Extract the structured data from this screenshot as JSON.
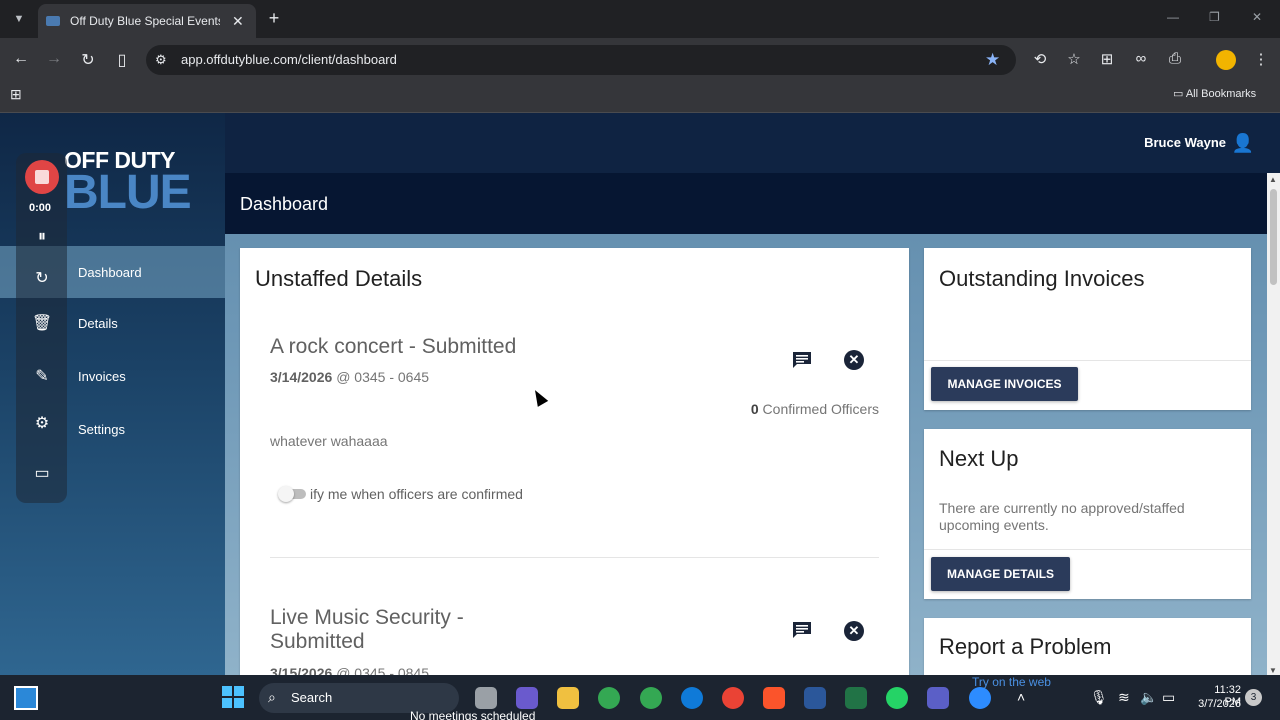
{
  "browser": {
    "tab_title": "Off Duty Blue Special Events &",
    "tab_close": "✕",
    "new_tab": "+",
    "url": "app.offdutyblue.com/client/dashboard",
    "bookmarks_label": "All Bookmarks"
  },
  "app": {
    "logo_top": "OFF DUTY",
    "logo_bottom": "BLUE",
    "user_name": "Bruce Wayne",
    "page_title": "Dashboard",
    "nav": [
      {
        "label": "Dashboard",
        "active": true
      },
      {
        "label": "Details"
      },
      {
        "label": "Invoices"
      },
      {
        "label": "Settings"
      }
    ]
  },
  "recorder": {
    "time": "0:00"
  },
  "unstaffed": {
    "title": "Unstaffed Details",
    "events": [
      {
        "title": "A rock concert - Submitted",
        "date": "3/14/2026",
        "time": "@ 0345 - 0645",
        "officers_count": "0",
        "officers_label": "Confirmed Officers",
        "notes": "whatever wahaaaa",
        "toggle_label": "ify me when officers are confirmed"
      },
      {
        "title_line1": "Live Music Security -",
        "title_line2": "Submitted",
        "date": "3/15/2026",
        "time": "@ 0345 - 0845"
      }
    ]
  },
  "invoices": {
    "title": "Outstanding Invoices",
    "button": "MANAGE INVOICES"
  },
  "next_up": {
    "title": "Next Up",
    "message": "There are currently no approved/staffed upcoming events.",
    "button": "MANAGE DETAILS"
  },
  "report": {
    "title": "Report a Problem"
  },
  "taskbar": {
    "search_label": "Search",
    "meeting_text": "No meetings scheduled",
    "try_web": "Try on the web",
    "time": "11:32 PM",
    "date": "3/7/2026",
    "notifications": "3"
  }
}
